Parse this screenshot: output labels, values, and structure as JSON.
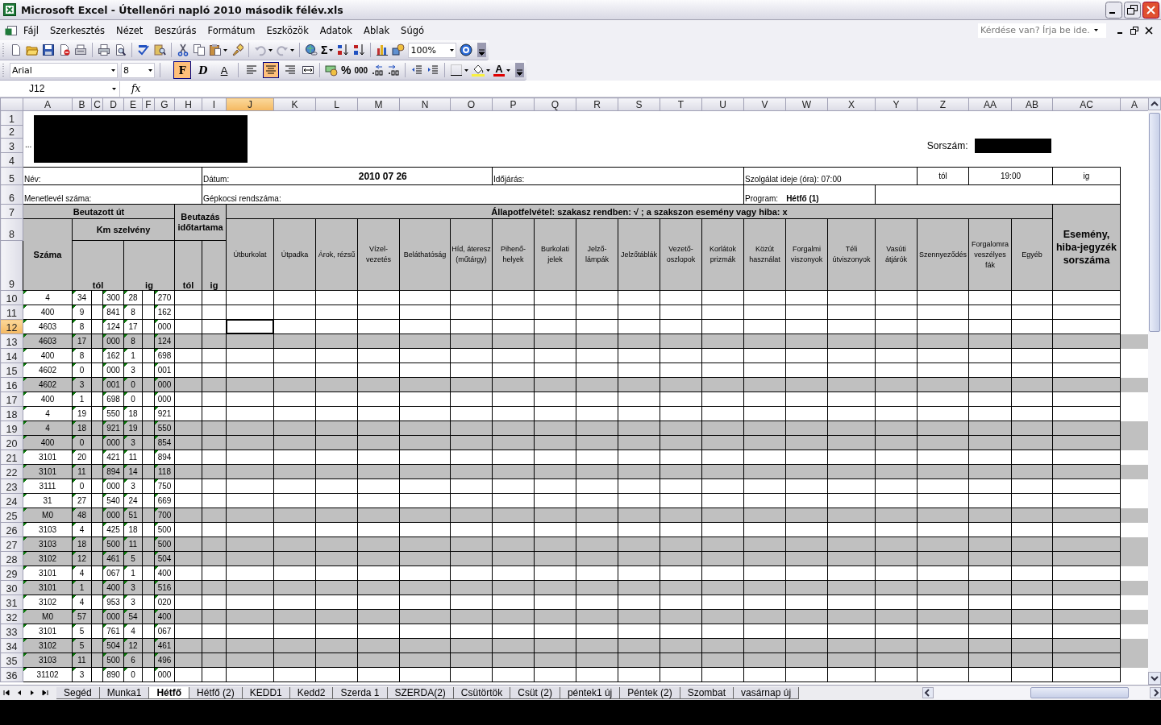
{
  "window": {
    "title": "Microsoft Excel - Útellenőri  napló 2010 második félév.xls"
  },
  "menu": [
    "Fájl",
    "Szerkesztés",
    "Nézet",
    "Beszúrás",
    "Formátum",
    "Eszközök",
    "Adatok",
    "Ablak",
    "Súgó"
  ],
  "help_box": {
    "placeholder": "Kérdése van? Írja be ide."
  },
  "standard_toolbar": {
    "sum_symbol": "Σ",
    "zoom": "100%"
  },
  "formatting_toolbar": {
    "font": "Arial",
    "size": "8",
    "styles": [
      {
        "label": "F",
        "kind": "bold",
        "on": true
      },
      {
        "label": "D",
        "kind": "italic",
        "on": false
      },
      {
        "label": "A",
        "kind": "underline",
        "on": false
      }
    ],
    "alignment_buttons": [
      {
        "on": false
      },
      {
        "on": true
      },
      {
        "on": false
      }
    ],
    "percent": "%",
    "thousands": "000",
    "font_color_label": "A"
  },
  "formula_bar": {
    "name_box": "J12",
    "fx": "fx"
  },
  "columns": [
    {
      "label": "A",
      "selected": false
    },
    {
      "label": "B",
      "selected": false
    },
    {
      "label": "C",
      "selected": false
    },
    {
      "label": "D",
      "selected": false
    },
    {
      "label": "E",
      "selected": false
    },
    {
      "label": "F",
      "selected": false
    },
    {
      "label": "G",
      "selected": false
    },
    {
      "label": "H",
      "selected": false
    },
    {
      "label": "I",
      "selected": false
    },
    {
      "label": "J",
      "selected": true
    },
    {
      "label": "K",
      "selected": false
    },
    {
      "label": "L",
      "selected": false
    },
    {
      "label": "M",
      "selected": false
    },
    {
      "label": "N",
      "selected": false
    },
    {
      "label": "O",
      "selected": false
    },
    {
      "label": "P",
      "selected": false
    },
    {
      "label": "Q",
      "selected": false
    },
    {
      "label": "R",
      "selected": false
    },
    {
      "label": "S",
      "selected": false
    },
    {
      "label": "T",
      "selected": false
    },
    {
      "label": "U",
      "selected": false
    },
    {
      "label": "V",
      "selected": false
    },
    {
      "label": "W",
      "selected": false
    },
    {
      "label": "X",
      "selected": false
    },
    {
      "label": "Y",
      "selected": false
    },
    {
      "label": "Z",
      "selected": false
    },
    {
      "label": "AA",
      "selected": false
    },
    {
      "label": "AB",
      "selected": false
    },
    {
      "label": "AC",
      "selected": false
    },
    {
      "label": "A",
      "selected": false
    }
  ],
  "sheet": {
    "header_row_numbers": [
      "1",
      "2",
      "3",
      "4",
      "5",
      "6",
      "7",
      "8",
      "9"
    ],
    "top_left_mark": "...",
    "serial_label": "Sorszám:",
    "name_label": "Név:",
    "date_label": "Dátum:",
    "date": "2010 07 26",
    "weather_label": "Időjárás:",
    "duty_time": "Szolgálat ideje (óra):  07:00",
    "from_label": "tól",
    "to_time": "19:00",
    "to_label": "ig",
    "waybill_label": "Menetlevél száma:",
    "plate_label": "Gépkocsi rendszáma:",
    "program_label": "Program:",
    "program": "Hétfő (1)",
    "route_heading": "Beutazott út",
    "duration_heading": "Beutazás időtartama",
    "survey_heading": "**Állapotfelvétel: szakasz rendben: √ ; a szakszon esemény vagy hiba:** x",
    "event_heading": "Esemény, hiba-jegyzék sorszáma",
    "number_heading": "Száma",
    "km_heading": "Km szelvény",
    "km_from": "tól",
    "km_to": "ig",
    "time_from": "tól",
    "time_to": "ig",
    "survey_columns": [
      "Útburkolat",
      "Útpadka",
      "Árok, rézsű",
      "Vízel-vezetés",
      "Beláthatóság",
      "Híd, áteresz (műtárgy)",
      "Pihenő-helyek",
      "Burkolati jelek",
      "Jelző-lámpák",
      "Jelzőtáblák",
      "Vezető-oszlopok",
      "Korlátok prizmák",
      "Közút használat",
      "Forgalmi viszonyok",
      "Téli útviszonyok",
      "Vasúti átjárók",
      "Szennyeződés",
      "Forgalomra veszélyes fák",
      "Egyéb"
    ],
    "rows": [
      {
        "number": "10",
        "selected": false,
        "shaded": false,
        "cells": [
          "4",
          "34",
          "300",
          "28",
          "270"
        ]
      },
      {
        "number": "11",
        "selected": false,
        "shaded": false,
        "cells": [
          "400",
          "9",
          "841",
          "8",
          "162"
        ]
      },
      {
        "number": "12",
        "selected": true,
        "shaded": false,
        "cells": [
          "4603",
          "8",
          "124",
          "17",
          "000"
        ]
      },
      {
        "number": "13",
        "selected": false,
        "shaded": true,
        "cells": [
          "4603",
          "17",
          "000",
          "8",
          "124"
        ]
      },
      {
        "number": "14",
        "selected": false,
        "shaded": false,
        "cells": [
          "400",
          "8",
          "162",
          "1",
          "698"
        ]
      },
      {
        "number": "15",
        "selected": false,
        "shaded": false,
        "cells": [
          "4602",
          "0",
          "000",
          "3",
          "001"
        ]
      },
      {
        "number": "16",
        "selected": false,
        "shaded": true,
        "cells": [
          "4602",
          "3",
          "001",
          "0",
          "000"
        ]
      },
      {
        "number": "17",
        "selected": false,
        "shaded": false,
        "cells": [
          "400",
          "1",
          "698",
          "0",
          "000"
        ]
      },
      {
        "number": "18",
        "selected": false,
        "shaded": false,
        "cells": [
          "4",
          "19",
          "550",
          "18",
          "921"
        ]
      },
      {
        "number": "19",
        "selected": false,
        "shaded": true,
        "cells": [
          "4",
          "18",
          "921",
          "19",
          "550"
        ]
      },
      {
        "number": "20",
        "selected": false,
        "shaded": true,
        "cells": [
          "400",
          "0",
          "000",
          "3",
          "854"
        ]
      },
      {
        "number": "21",
        "selected": false,
        "shaded": false,
        "cells": [
          "3101",
          "20",
          "421",
          "11",
          "894"
        ]
      },
      {
        "number": "22",
        "selected": false,
        "shaded": true,
        "cells": [
          "3101",
          "11",
          "894",
          "14",
          "118"
        ]
      },
      {
        "number": "23",
        "selected": false,
        "shaded": false,
        "cells": [
          "3111",
          "0",
          "000",
          "3",
          "750"
        ]
      },
      {
        "number": "24",
        "selected": false,
        "shaded": false,
        "cells": [
          "31",
          "27",
          "540",
          "24",
          "669"
        ]
      },
      {
        "number": "25",
        "selected": false,
        "shaded": true,
        "cells": [
          "M0",
          "48",
          "000",
          "51",
          "700"
        ]
      },
      {
        "number": "26",
        "selected": false,
        "shaded": false,
        "cells": [
          "3103",
          "4",
          "425",
          "18",
          "500"
        ]
      },
      {
        "number": "27",
        "selected": false,
        "shaded": true,
        "cells": [
          "3103",
          "18",
          "500",
          "11",
          "500"
        ]
      },
      {
        "number": "28",
        "selected": false,
        "shaded": true,
        "cells": [
          "3102",
          "12",
          "461",
          "5",
          "504"
        ]
      },
      {
        "number": "29",
        "selected": false,
        "shaded": false,
        "cells": [
          "3101",
          "4",
          "067",
          "1",
          "400"
        ]
      },
      {
        "number": "30",
        "selected": false,
        "shaded": true,
        "cells": [
          "3101",
          "1",
          "400",
          "3",
          "516"
        ]
      },
      {
        "number": "31",
        "selected": false,
        "shaded": false,
        "cells": [
          "3102",
          "4",
          "953",
          "3",
          "020"
        ]
      },
      {
        "number": "32",
        "selected": false,
        "shaded": true,
        "cells": [
          "M0",
          "57",
          "000",
          "54",
          "400"
        ]
      },
      {
        "number": "33",
        "selected": false,
        "shaded": false,
        "cells": [
          "3101",
          "5",
          "761",
          "4",
          "067"
        ]
      },
      {
        "number": "34",
        "selected": false,
        "shaded": true,
        "cells": [
          "3102",
          "5",
          "504",
          "12",
          "461"
        ]
      },
      {
        "number": "35",
        "selected": false,
        "shaded": true,
        "cells": [
          "3103",
          "11",
          "500",
          "6",
          "496"
        ]
      },
      {
        "number": "36",
        "selected": false,
        "shaded": false,
        "cells": [
          "31102",
          "3",
          "890",
          "0",
          "000"
        ]
      }
    ]
  },
  "tabs": [
    {
      "label": "Segéd",
      "selected": false
    },
    {
      "label": "Munka1",
      "selected": false
    },
    {
      "label": "Hétfő",
      "selected": true
    },
    {
      "label": "Hétfő (2)",
      "selected": false
    },
    {
      "label": "KEDD1",
      "selected": false
    },
    {
      "label": "Kedd2",
      "selected": false
    },
    {
      "label": "Szerda 1",
      "selected": false
    },
    {
      "label": "SZERDA(2)",
      "selected": false
    },
    {
      "label": "Csütörtök",
      "selected": false
    },
    {
      "label": "Csüt (2)",
      "selected": false
    },
    {
      "label": "péntek1 új",
      "selected": false
    },
    {
      "label": "Péntek (2)",
      "selected": false
    },
    {
      "label": "Szombat",
      "selected": false
    },
    {
      "label": "vasárnap új",
      "selected": false
    }
  ]
}
